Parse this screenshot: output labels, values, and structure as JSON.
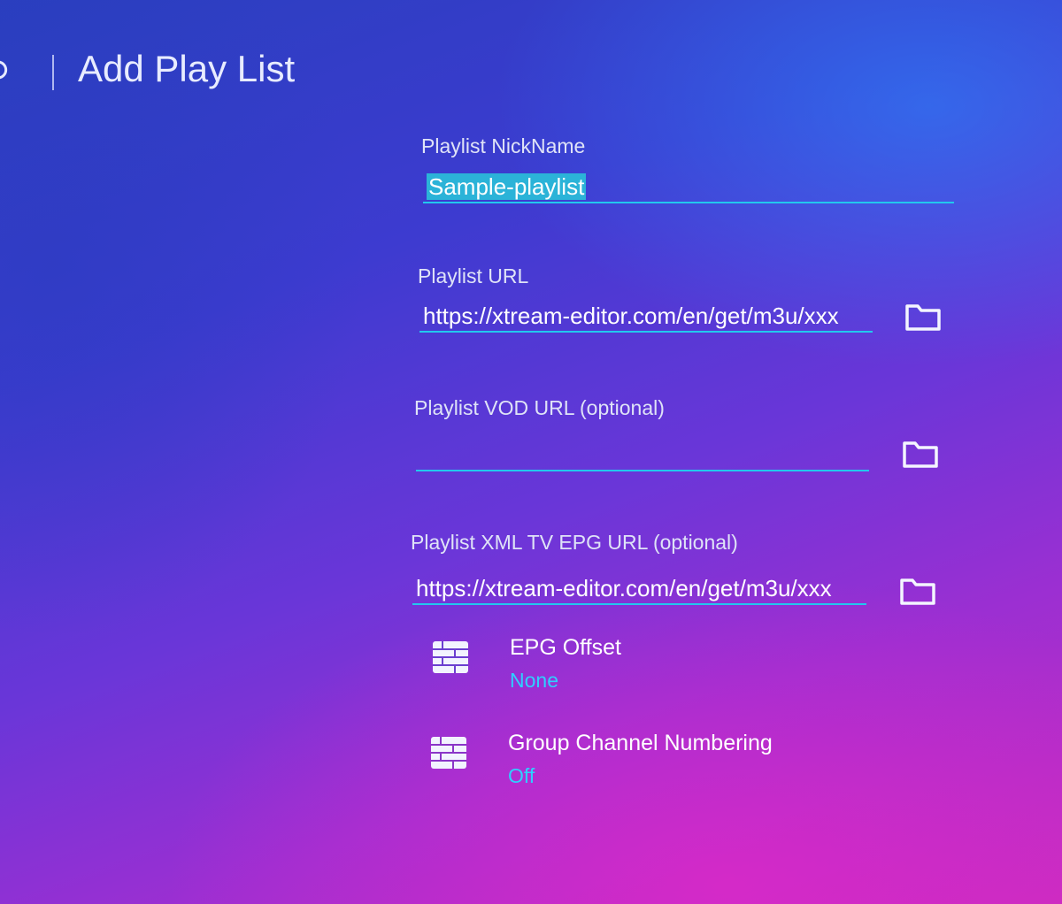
{
  "header": {
    "title": "Add Play List",
    "back_icon": "back-arrow-icon"
  },
  "form": {
    "nickname": {
      "label": "Playlist NickName",
      "value": "Sample-playlist"
    },
    "url": {
      "label": "Playlist URL",
      "value": "https://xtream-editor.com/en/get/m3u/xxx",
      "icon": "folder-icon"
    },
    "vod_url": {
      "label": "Playlist VOD URL (optional)",
      "value": "",
      "icon": "folder-icon"
    },
    "epg_url": {
      "label": "Playlist XML TV EPG URL (optional)",
      "value": "https://xtream-editor.com/en/get/m3u/xxx",
      "icon": "folder-icon"
    }
  },
  "settings": [
    {
      "title": "EPG Offset",
      "value": "None",
      "icon": "list-grid-icon"
    },
    {
      "title": "Group Channel Numbering",
      "value": "Off",
      "icon": "list-grid-icon"
    }
  ],
  "colors": {
    "accent": "#22c8ee",
    "value_text": "#2ed0ff",
    "selection": "#2bb3d8"
  }
}
